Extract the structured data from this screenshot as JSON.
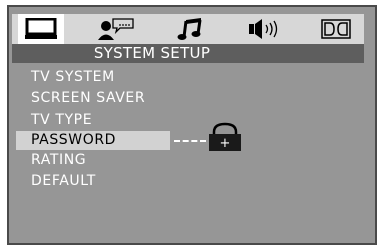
{
  "toolbar": {
    "tabs": [
      {
        "icon": "monitor-icon",
        "selected": true
      },
      {
        "icon": "person-speech-icon",
        "selected": false
      },
      {
        "icon": "music-note-icon",
        "selected": false
      },
      {
        "icon": "speaker-icon",
        "selected": false
      },
      {
        "icon": "dolby-dd-icon",
        "selected": false
      }
    ]
  },
  "header": {
    "title": "SYSTEM SETUP"
  },
  "menu": {
    "items": [
      {
        "label": "TV SYSTEM"
      },
      {
        "label": "SCREEN SAVER"
      },
      {
        "label": "TV TYPE"
      },
      {
        "label": "PASSWORD",
        "selected": true
      },
      {
        "label": "RATING"
      },
      {
        "label": "DEFAULT"
      }
    ]
  },
  "password_lock": {
    "icon": "padlock-icon",
    "glyph": "+"
  }
}
